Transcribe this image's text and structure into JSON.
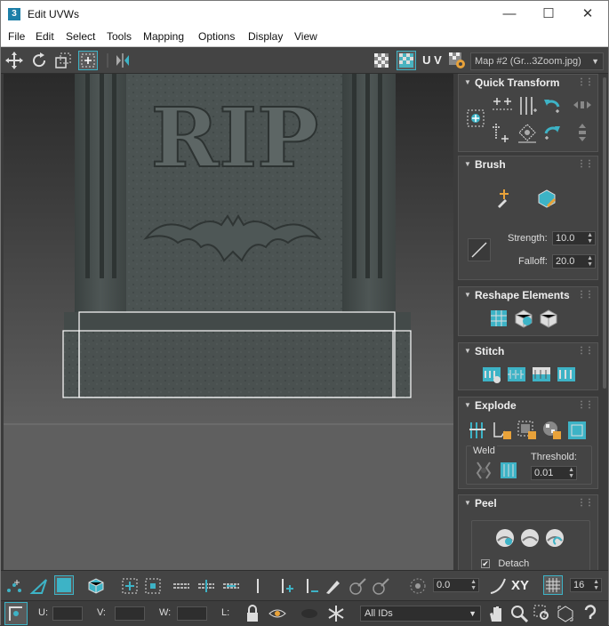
{
  "window": {
    "title": "Edit UVWs",
    "icon": "3",
    "minimize": "—",
    "maximize": "☐",
    "close": "✕"
  },
  "menu": [
    "File",
    "Edit",
    "Select",
    "Tools",
    "Mapping",
    "Options",
    "Display",
    "View"
  ],
  "toolbar": {
    "uv_label": "U V",
    "map_select": "Map #2 (Gr...3Zoom.jpg)"
  },
  "viewport": {
    "carved_text": "RIP"
  },
  "rollouts": {
    "quick_transform": "Quick Transform",
    "brush": {
      "title": "Brush",
      "strength_label": "Strength:",
      "strength_value": "10.0",
      "falloff_label": "Falloff:",
      "falloff_value": "20.0"
    },
    "reshape": "Reshape Elements",
    "stitch": "Stitch",
    "explode": {
      "title": "Explode",
      "weld_label": "Weld",
      "threshold_label": "Threshold:",
      "threshold_value": "0.01"
    },
    "peel": {
      "title": "Peel",
      "detach_label": "Detach",
      "detach_checked": true
    }
  },
  "bottom": {
    "rotate_value": "0.0",
    "xy_label": "XY",
    "count_value": "16",
    "u_label": "U:",
    "v_label": "V:",
    "w_label": "W:",
    "l_label": "L:",
    "ids_select": "All IDs"
  },
  "colors": {
    "accent": "#3db3c6",
    "panel": "#444444",
    "viewport": "#5a5a5a",
    "orange": "#e8a23a"
  }
}
